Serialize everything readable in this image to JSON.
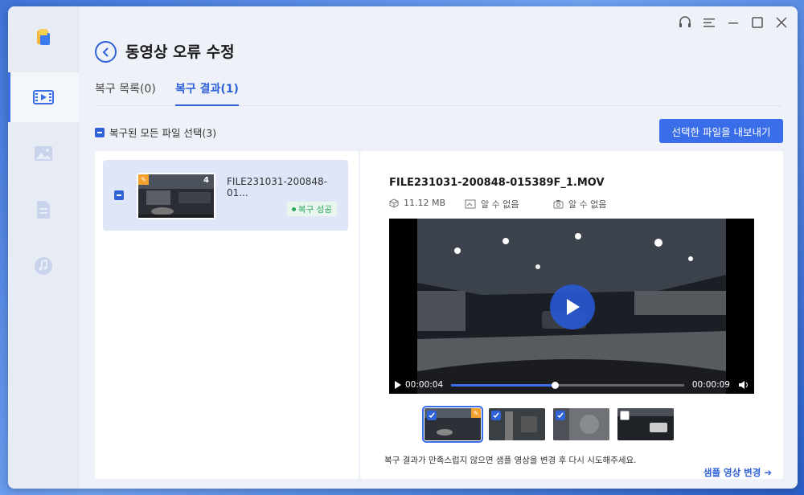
{
  "page": {
    "title": "동영상 오류 수정"
  },
  "sidebar": {
    "items": [
      {
        "icon": "video-repair-icon",
        "active": true
      },
      {
        "icon": "photo-repair-icon",
        "active": false
      },
      {
        "icon": "document-repair-icon",
        "active": false
      },
      {
        "icon": "audio-repair-icon",
        "active": false
      }
    ]
  },
  "tabs": [
    {
      "label": "복구 목록(0)",
      "active": false
    },
    {
      "label": "복구 결과(1)",
      "active": true
    }
  ],
  "toolbar": {
    "select_all_label": "복구된 모든 파일 선택(3)",
    "export_label": "선택한 파일을 내보내기"
  },
  "file_list": [
    {
      "name": "FILE231031-200848-01...",
      "thumb_count": "4",
      "status": "복구 성공"
    }
  ],
  "detail": {
    "file_name": "FILE231031-200848-015389F_1.MOV",
    "size": "11.12 MB",
    "resolution": "알 수 없음",
    "camera": "알 수 없음",
    "current_time": "00:00:04",
    "duration": "00:00:09",
    "progress": 0.4444,
    "samples": [
      {
        "checked": true,
        "selected": true,
        "badge": true
      },
      {
        "checked": true,
        "selected": false,
        "badge": false
      },
      {
        "checked": true,
        "selected": false,
        "badge": false
      },
      {
        "checked": false,
        "selected": false,
        "badge": false
      }
    ],
    "hint": "복구 결과가 만족스럽지 않으면 샘플 영상을 변경 후 다시 시도해주세요.",
    "change_link": "샘플 영상 변경 ➔"
  },
  "colors": {
    "accent": "#3a6ee8",
    "success": "#2aa85c",
    "badge": "#f4a132"
  }
}
